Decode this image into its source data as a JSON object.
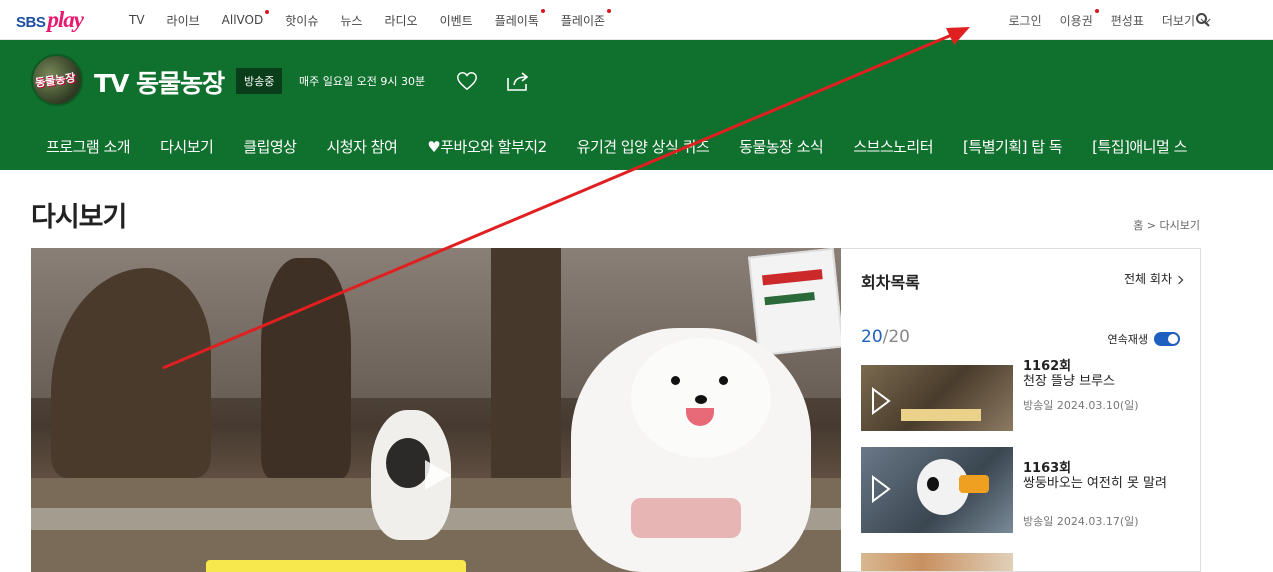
{
  "top": {
    "logo_sbs": "SBS",
    "logo_play": "play",
    "nav": [
      {
        "label": "TV",
        "dot": false
      },
      {
        "label": "라이브",
        "dot": false
      },
      {
        "label": "AllVOD",
        "dot": true
      },
      {
        "label": "핫이슈",
        "dot": false
      },
      {
        "label": "뉴스",
        "dot": false
      },
      {
        "label": "라디오",
        "dot": false
      },
      {
        "label": "이벤트",
        "dot": false
      },
      {
        "label": "플레이톡",
        "dot": true
      },
      {
        "label": "플레이존",
        "dot": true
      }
    ],
    "login": "로그인",
    "ticket": "이용권",
    "schedule": "편성표",
    "more": "더보기"
  },
  "program": {
    "avatar_text": "동물농장",
    "title": "TV 동물농장",
    "onair": "방송중",
    "schedule": "매주 일요일 오전 9시 30분",
    "menu": [
      "프로그램 소개",
      "다시보기",
      "클립영상",
      "시청자 참여",
      "♥푸바오와 할부지2",
      "유기견 입양 상식 퀴즈",
      "동물농장 소식",
      "스브스노리터",
      "[특별기획] 탑 독",
      "[특집]애니멀 스"
    ],
    "active_menu": "다시보기"
  },
  "page": {
    "title": "다시보기",
    "breadcrumb": "홈 > 다시보기"
  },
  "episodes": {
    "heading": "회차목록",
    "all_label": "전체 회차",
    "current": "20",
    "total": "/20",
    "autoplay_label": "연속재생",
    "autoplay_on": true,
    "items": [
      {
        "num": "1162회",
        "title": "천장 뜰냥 브루스",
        "date": "방송일 2024.03.10(일)"
      },
      {
        "num": "1163회",
        "title": "쌍둥바오는 여전히 못 말려",
        "date": "방송일 2024.03.17(일)"
      }
    ]
  },
  "colors": {
    "brand_green": "#10702e",
    "accent_blue": "#1f5fbf",
    "annotation_red": "#e02020"
  }
}
